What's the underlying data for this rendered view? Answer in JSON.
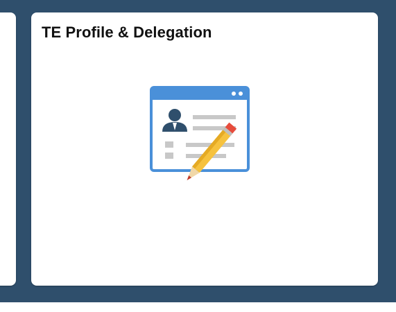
{
  "tile": {
    "title": "TE Profile & Delegation",
    "icon": "profile-edit-icon"
  },
  "colors": {
    "background": "#2f4f6c",
    "tile": "#ffffff",
    "icon_frame": "#4a90d9",
    "icon_person": "#2f4f6c",
    "icon_lines": "#c8c8c8",
    "pencil_body": "#f6c23e",
    "pencil_eraser": "#e74c3c"
  }
}
